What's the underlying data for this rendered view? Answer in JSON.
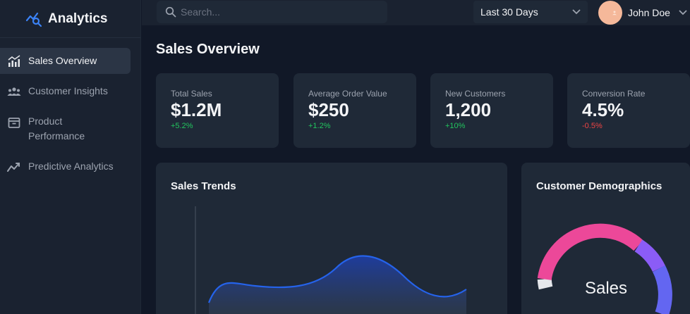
{
  "brand": {
    "name": "Analytics",
    "logo_icon": "chart-search-icon",
    "accent": "#3b82f6"
  },
  "sidebar": {
    "items": [
      {
        "label": "Sales Overview",
        "icon": "bar-chart-icon",
        "active": true
      },
      {
        "label": "Customer Insights",
        "icon": "users-icon",
        "active": false
      },
      {
        "label": "Product Performance",
        "icon": "archive-icon",
        "active": false
      },
      {
        "label": "Predictive Analytics",
        "icon": "trend-icon",
        "active": false
      }
    ]
  },
  "topbar": {
    "search_placeholder": "Search...",
    "date_range": "Last 30 Days",
    "user_name": "John Doe"
  },
  "page": {
    "title": "Sales Overview"
  },
  "kpis": [
    {
      "label": "Total Sales",
      "value": "$1.2M",
      "change": "+5.2%",
      "trend": "up"
    },
    {
      "label": "Average Order Value",
      "value": "$250",
      "change": "+1.2%",
      "trend": "up"
    },
    {
      "label": "New Customers",
      "value": "1,200",
      "change": "+10%",
      "trend": "up"
    },
    {
      "label": "Conversion Rate",
      "value": "4.5%",
      "change": "-0.5%",
      "trend": "down"
    }
  ],
  "panels": {
    "trends_title": "Sales Trends",
    "demographics_title": "Customer Demographics",
    "donut_center_label": "Sales"
  },
  "colors": {
    "positive": "#22c55e",
    "negative": "#ef4444",
    "line": "#2563eb",
    "donut_pink": "#ec4899",
    "donut_purple": "#8b5cf6",
    "donut_blue": "#6366f1"
  }
}
